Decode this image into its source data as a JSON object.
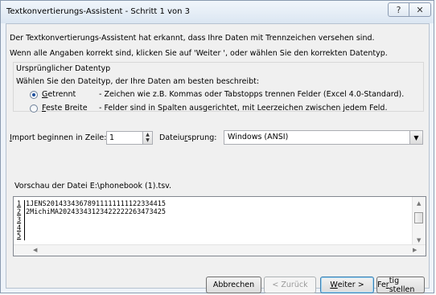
{
  "window": {
    "title": "Textkonvertierungs-Assistent - Schritt 1 von 3",
    "help_glyph": "?",
    "close_glyph": "✕"
  },
  "intro": {
    "line1": "Der Textkonvertierungs-Assistent hat erkannt, dass Ihre Daten mit Trennzeichen versehen sind.",
    "line2": "Wenn alle Angaben korrekt sind, klicken Sie auf 'Weiter ', oder wählen Sie den korrekten Datentyp."
  },
  "datatype": {
    "group_label": "Ursprünglicher Datentyp",
    "prompt": "Wählen Sie den Dateityp, der Ihre Daten am besten beschreibt:",
    "options": [
      {
        "accel": "G",
        "rest": "etrennt",
        "desc": "- Zeichen wie z.B. Kommas oder Tabstopps trennen Felder (Excel 4.0-Standard).",
        "checked": true
      },
      {
        "accel": "F",
        "rest": "este Breite",
        "desc": "- Felder sind in Spalten ausgerichtet, mit Leerzeichen zwischen jedem Feld.",
        "checked": false
      }
    ]
  },
  "import": {
    "label_pre": "",
    "label_accel": "I",
    "label_post": "mport beginnen in Zeile:",
    "row_value": "1",
    "origin_label_pre": "Dateiu",
    "origin_label_accel": "r",
    "origin_label_post": "sprung:",
    "origin_value": "Windows (ANSI)"
  },
  "preview": {
    "label": "Vorschau der Datei E:\\phonebook (1).tsv.",
    "rows": [
      {
        "num": "1",
        "text": "1JENS20143343678911111111122334415"
      },
      {
        "num": "2",
        "text": "2MichiMA20243343123422222263473425"
      },
      {
        "num": "3",
        "text": ""
      },
      {
        "num": "4",
        "text": ""
      },
      {
        "num": "5",
        "text": ""
      }
    ]
  },
  "buttons": {
    "cancel": "Abbrechen",
    "back": "< Zurück",
    "next_accel": "W",
    "next_rest": "eiter >",
    "finish_pre": "Fe",
    "finish_accel": "r",
    "finish_post": "tig stellen"
  }
}
